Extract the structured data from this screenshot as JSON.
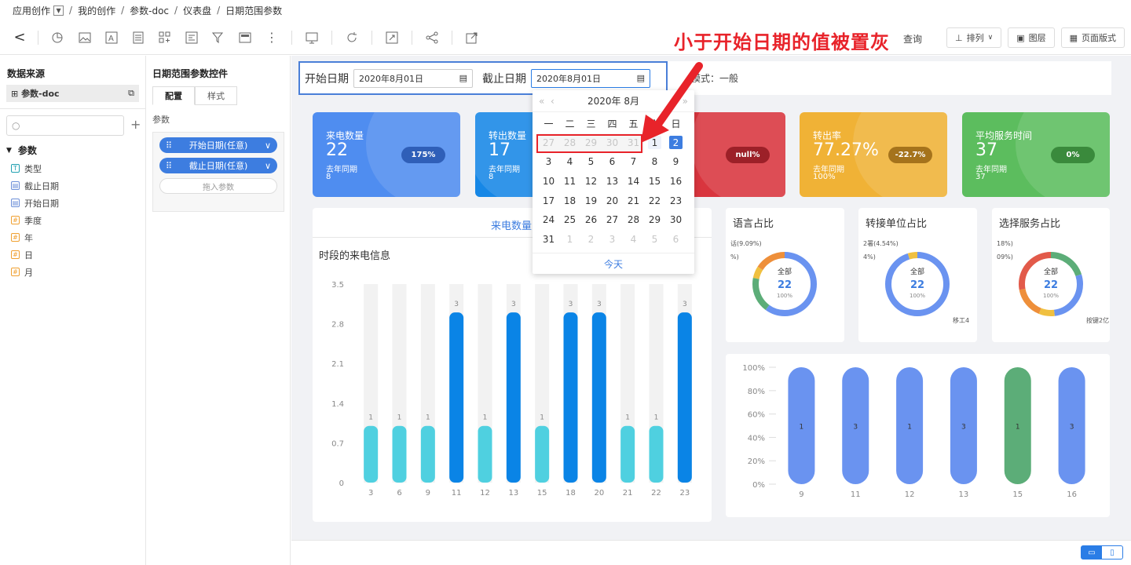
{
  "breadcrumb": [
    "应用创作",
    "我的创作",
    "参数-doc",
    "仪表盘",
    "日期范围参数"
  ],
  "toolbar": {
    "query": "查询",
    "sort": "排列",
    "layers": "图层",
    "page_layout": "页面版式"
  },
  "annotation": "小于开始日期的值被置灰",
  "datasource": {
    "title": "数据来源",
    "name": "参数-doc",
    "search_placeholder": "",
    "group": "参数",
    "fields": [
      {
        "name": "类型",
        "kind": "text"
      },
      {
        "name": "截止日期",
        "kind": "date"
      },
      {
        "name": "开始日期",
        "kind": "date"
      },
      {
        "name": "季度",
        "kind": "number"
      },
      {
        "name": "年",
        "kind": "number"
      },
      {
        "name": "日",
        "kind": "number"
      },
      {
        "name": "月",
        "kind": "number"
      }
    ]
  },
  "param_panel": {
    "title": "日期范围参数控件",
    "tab_config": "配置",
    "tab_style": "样式",
    "section": "参数",
    "pill_start": "开始日期(任意)",
    "pill_end": "截止日期(任意)",
    "drag_hint": "拖入参数"
  },
  "filter": {
    "start_label": "开始日期",
    "start_value": "2020年8月01日",
    "end_label": "截止日期",
    "end_value": "2020年8月01日",
    "mode_text": "模式：一般"
  },
  "datepicker": {
    "title": "2020年 8月",
    "weekdays": [
      "一",
      "二",
      "三",
      "四",
      "五",
      "六",
      "日"
    ],
    "today": "今天",
    "rows": [
      [
        "27",
        "28",
        "29",
        "30",
        "31",
        "1",
        "2"
      ],
      [
        "3",
        "4",
        "5",
        "6",
        "7",
        "8",
        "9"
      ],
      [
        "10",
        "11",
        "12",
        "13",
        "14",
        "15",
        "16"
      ],
      [
        "17",
        "18",
        "19",
        "20",
        "21",
        "22",
        "23"
      ],
      [
        "24",
        "25",
        "26",
        "27",
        "28",
        "29",
        "30"
      ],
      [
        "31",
        "1",
        "2",
        "3",
        "4",
        "5",
        "6"
      ]
    ]
  },
  "kpis": [
    {
      "title": "来电数量",
      "value": "22",
      "sub": "去年同期",
      "sub_value": "8",
      "badge": "175%",
      "color": "#4f8df0",
      "badge_color": "#2f5fb8"
    },
    {
      "title": "转出数量",
      "value": "17",
      "sub": "去年同期",
      "sub_value": "8",
      "badge": "",
      "color": "#1687e6",
      "badge_color": "#0e5ea8"
    },
    {
      "title": "",
      "value": "",
      "sub": "",
      "sub_value": "",
      "badge": "null%",
      "color": "#d9353e",
      "badge_color": "#9c2028"
    },
    {
      "title": "转出率",
      "value": "77.27%",
      "sub": "去年同期",
      "sub_value": "100%",
      "badge": "-22.7%",
      "color": "#f0b236",
      "badge_color": "#a5731c"
    },
    {
      "title": "平均服务时间",
      "value": "37",
      "sub": "去年同期",
      "sub_value": "37",
      "badge": "0%",
      "color": "#5cbd5e",
      "badge_color": "#3a8a3c"
    }
  ],
  "main_chart": {
    "tab": "来电数量",
    "title": "时段的来电信息"
  },
  "donuts": [
    {
      "title": "语言占比",
      "center": "全部",
      "total": "22",
      "pct": "100%",
      "label_left1": "话(9.09%)",
      "label_left2": "%)",
      "label_right": ""
    },
    {
      "title": "转接单位占比",
      "center": "全部",
      "total": "22",
      "pct": "100%",
      "label_left1": "2署(4.54%)",
      "label_left2": "4%)",
      "label_right": "移工4"
    },
    {
      "title": "选择服务占比",
      "center": "全部",
      "total": "22",
      "pct": "100%",
      "label_left1": "18%)",
      "label_left2": "09%)",
      "label_right": "按键2亿"
    }
  ],
  "chart_data": [
    {
      "type": "bar",
      "title": "时段的来电信息",
      "categories": [
        "3",
        "6",
        "9",
        "11",
        "12",
        "13",
        "15",
        "18",
        "20",
        "21",
        "22",
        "23"
      ],
      "values": [
        1,
        1,
        1,
        3,
        1,
        3,
        1,
        3,
        3,
        1,
        1,
        3
      ],
      "ylim": [
        0,
        3.5
      ],
      "yticks": [
        "0",
        "0.7",
        "1.4",
        "2.1",
        "2.8",
        "3.5"
      ],
      "colors": {
        "low": "#4fd0e0",
        "high": "#0a84e6",
        "track": "#f2f2f2"
      }
    },
    {
      "type": "bar",
      "title": "",
      "categories": [
        "9",
        "11",
        "12",
        "13",
        "15",
        "16"
      ],
      "values": [
        1,
        3,
        1,
        3,
        1,
        3
      ],
      "ylim": [
        0,
        1
      ],
      "yticks": [
        "0%",
        "20%",
        "40%",
        "60%",
        "80%",
        "100%"
      ],
      "colors": {
        "default": "#6a93f0",
        "highlight": "#5cad78"
      },
      "highlight_index": 4
    }
  ]
}
